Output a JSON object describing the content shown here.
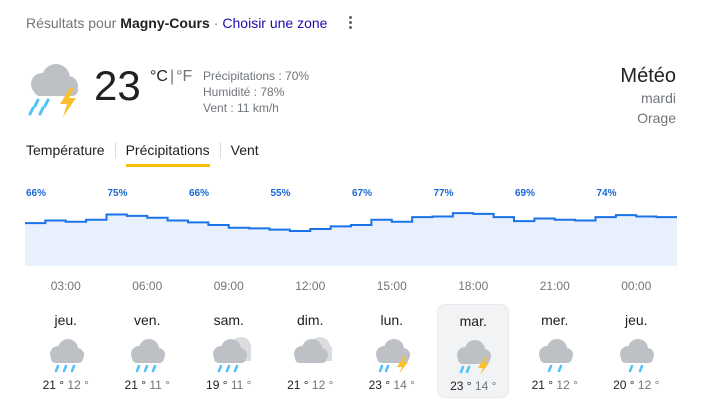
{
  "header": {
    "prefix": "Résultats pour",
    "location": "Magny-Cours",
    "separator": "·",
    "zone_link": "Choisir une zone"
  },
  "current": {
    "icon": "thunderstorm-rain-icon",
    "temp": "23",
    "unit_c": "°C",
    "unit_sep": "|",
    "unit_f": "°F",
    "precip": "Précipitations : 70%",
    "humidity": "Humidité : 78%",
    "wind": "Vent : 11 km/h"
  },
  "summary": {
    "title": "Météo",
    "day": "mardi",
    "condition": "Orage"
  },
  "tabs": [
    {
      "label": "Température",
      "active": false
    },
    {
      "label": "Précipitations",
      "active": true
    },
    {
      "label": "Vent",
      "active": false
    }
  ],
  "colors": {
    "accent_tab": "#fbbc04",
    "chart_line": "#1a73e8",
    "chart_fill": "#e8f0fe",
    "chart_label": "#1967d2",
    "rain": "#4fc3f7",
    "bolt": "#fbc02d",
    "cloud": "#9aa0a6"
  },
  "chart_data": {
    "type": "area",
    "series": [
      {
        "values": [
          62,
          66,
          64,
          67,
          75,
          73,
          70,
          66,
          63,
          59,
          55,
          54,
          52,
          50,
          53,
          57,
          59,
          67,
          64,
          71,
          72,
          77,
          76,
          71,
          65,
          69,
          67,
          66,
          71,
          74,
          72,
          71
        ]
      }
    ],
    "labels_shown": [
      "66%",
      "75%",
      "66%",
      "55%",
      "67%",
      "77%",
      "69%",
      "74%"
    ],
    "x_ticks": [
      "03:00",
      "06:00",
      "09:00",
      "12:00",
      "15:00",
      "18:00",
      "21:00",
      "00:00"
    ],
    "ylim": [
      0,
      100
    ]
  },
  "days": [
    {
      "name": "jeu.",
      "icon": "rain-icon",
      "hi": "21 °",
      "lo": "12 °",
      "selected": false
    },
    {
      "name": "ven.",
      "icon": "rain-icon",
      "hi": "21 °",
      "lo": "11 °",
      "selected": false
    },
    {
      "name": "sam.",
      "icon": "rain-cloudy-icon",
      "hi": "19 °",
      "lo": "11 °",
      "selected": false
    },
    {
      "name": "dim.",
      "icon": "cloudy-icon",
      "hi": "21 °",
      "lo": "12 °",
      "selected": false
    },
    {
      "name": "lun.",
      "icon": "thunderstorm-rain-icon",
      "hi": "23 °",
      "lo": "14 °",
      "selected": false
    },
    {
      "name": "mar.",
      "icon": "thunderstorm-rain-icon",
      "hi": "23 °",
      "lo": "14 °",
      "selected": true
    },
    {
      "name": "mer.",
      "icon": "light-rain-icon",
      "hi": "21 °",
      "lo": "12 °",
      "selected": false
    },
    {
      "name": "jeu.",
      "icon": "light-rain-icon",
      "hi": "20 °",
      "lo": "12 °",
      "selected": false
    }
  ]
}
